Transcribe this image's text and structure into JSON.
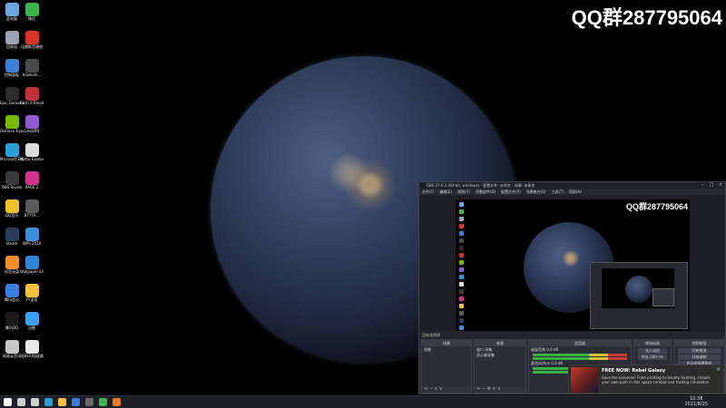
{
  "watermark": "QQ群287795064",
  "desktop": {
    "icons": [
      {
        "label": "此电脑",
        "color": "#6aa6e0",
        "icon": "computer-icon"
      },
      {
        "label": "微信",
        "color": "#3fb24a",
        "icon": "wechat-icon"
      },
      {
        "label": "回收站",
        "color": "#9aa4b4",
        "icon": "recycle-bin-icon"
      },
      {
        "label": "迅雷影音播放",
        "color": "#d8342c",
        "icon": "player-icon"
      },
      {
        "label": "控制面板",
        "color": "#3d7fd0",
        "icon": "control-panel-icon"
      },
      {
        "label": "InSekshi...",
        "color": "#4a4a4a",
        "icon": "app-icon"
      },
      {
        "label": "Epic Games Launcher",
        "color": "#2b2b2b",
        "icon": "epic-games-icon"
      },
      {
        "label": "Bash 9 Blood Beta",
        "color": "#c0323a",
        "icon": "game-icon"
      },
      {
        "label": "GeForce Experience",
        "color": "#76b900",
        "icon": "geforce-icon"
      },
      {
        "label": "LetsVPN",
        "color": "#8e5bd0",
        "icon": "vpn-icon"
      },
      {
        "label": "Microsoft Edge",
        "color": "#2a9fd8",
        "icon": "edge-icon"
      },
      {
        "label": "Metro Exodus",
        "color": "#dcdcdc",
        "icon": "metro-icon"
      },
      {
        "label": "OBS Studio",
        "color": "#3a3a3a",
        "icon": "obs-icon"
      },
      {
        "label": "RAGE 2",
        "color": "#d0348c",
        "icon": "rage-icon"
      },
      {
        "label": "QQ音乐",
        "color": "#f2c12e",
        "icon": "qq-music-icon"
      },
      {
        "label": "87779...",
        "color": "#5a5a5a",
        "icon": "file-icon"
      },
      {
        "label": "Steam",
        "color": "#2a3f5a",
        "icon": "steam-icon"
      },
      {
        "label": "WPS 2019",
        "color": "#3f8fd8",
        "icon": "wps-icon"
      },
      {
        "label": "阿里云盘",
        "color": "#f0902a",
        "icon": "cloud-drive-icon"
      },
      {
        "label": "Wallpaper Engine",
        "color": "#2f86d6",
        "icon": "wallpaper-engine-icon"
      },
      {
        "label": "腾讯会议",
        "color": "#3a7be0",
        "icon": "meeting-icon"
      },
      {
        "label": "YY语音",
        "color": "#f2c23a",
        "icon": "yy-icon"
      },
      {
        "label": "腾讯QQ",
        "color": "#1a1a1a",
        "icon": "qq-icon"
      },
      {
        "label": "迅雷",
        "color": "#3aa0f0",
        "icon": "thunder-icon"
      },
      {
        "label": "网易云音乐",
        "color": "#c8c8c8",
        "icon": "music-icon"
      },
      {
        "label": "网易UU加速器",
        "color": "#e8e8e8",
        "icon": "uu-icon"
      }
    ]
  },
  "obs": {
    "title": "OBS 27.0.1 (64-bit, windows) - 配置文件: 未命名 - 场景: 未命名",
    "menu": [
      "文件(F)",
      "编辑(E)",
      "视图(V)",
      "停靠部件(D)",
      "配置文件(P)",
      "场景集合(S)",
      "工具(T)",
      "帮助(H)"
    ],
    "preview_watermark": "QQ群287795064",
    "scene_tools": "没有选择源",
    "docks": {
      "scenes": {
        "title": "场景",
        "items": [
          "场景"
        ]
      },
      "sources": {
        "title": "来源",
        "items": [
          "窗口 采集",
          "显示器采集"
        ]
      },
      "mixer": {
        "title": "混音器",
        "items": [
          "桌面音频 0.0 dB",
          "麦克风/Aux 0.0 dB"
        ]
      },
      "transitions": {
        "title": "转场动画",
        "items": [
          "淡入淡出",
          "时长 300 ms"
        ]
      },
      "controls": {
        "title": "控制按钮",
        "buttons": [
          "开始推流",
          "开始录制",
          "启动虚拟摄像机",
          "工作室模式",
          "设置",
          "退出"
        ]
      }
    }
  },
  "toast": {
    "title": "FREE NOW: Rebel Galaxy",
    "body": "Save the universe! From pirating to bounty hunting, choose your own path in this space combat and trading simulation."
  },
  "taskbar": {
    "time": "10:38",
    "date": "2021/8/25",
    "apps": [
      "windows-start-icon",
      "search-icon",
      "task-view-icon",
      "edge-icon",
      "file-explorer-icon",
      "store-icon",
      "obs-icon",
      "wechat-icon",
      "browser-icon"
    ]
  }
}
